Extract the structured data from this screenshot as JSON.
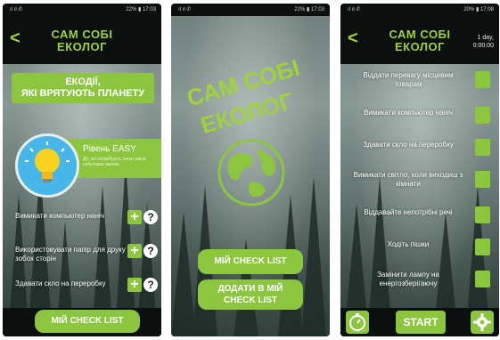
{
  "screen1": {
    "status_left": "ıl ıl ✆",
    "status_right": "22% ▮ 17:03",
    "title_line1": "САМ СОБІ",
    "title_line2": "ЕКОЛОГ",
    "banner_line1": "ЕКОДІЇ,",
    "banner_line2": "ЯКІ ВРЯТУЮТЬ ПЛАНЕТУ",
    "level_title": "Рівень EASY",
    "level_desc": "Дії, які потребують лише зміни побутових звичок",
    "tasks": [
      {
        "label": "Вимикати компьютер наніч"
      },
      {
        "label": "Використовувати папір для друку зобох сторін"
      },
      {
        "label": "Здавати скло на переробку"
      }
    ],
    "checklist_button": "МІЙ CHECK LIST"
  },
  "screen2": {
    "status_left": "ıl ıl ✆",
    "status_right": "22% ▮ 17:03",
    "logo_line1": "САМ СОБІ",
    "logo_line2": "ЕКОЛОГ",
    "checklist_button": "МІЙ CHECK LIST",
    "add_line1": "ДОДАТИ В МІЙ",
    "add_line2": "CHECK LIST"
  },
  "screen3": {
    "status_left": "ıl ıl ✆",
    "status_right": "20% ▮ 17:08",
    "title_line1": "САМ СОБІ",
    "title_line2": "ЕКОЛОГ",
    "timer_line1": "1 day,",
    "timer_line2": "0:00:00",
    "items": [
      {
        "label": "Віддати перевагу місцевим товарам"
      },
      {
        "label": "Вимикати компьютер наніч"
      },
      {
        "label": "Здавати скло на переробку"
      },
      {
        "label": "Вимикати світло, коли виходиш з кімнати"
      },
      {
        "label": "Віддавайте непотрібні речі"
      },
      {
        "label": "Ходіть пішки"
      },
      {
        "label": "Замінити лампу на енергозберігаючу"
      }
    ],
    "start_button": "START"
  },
  "icons": {
    "back": "chevron-left-icon",
    "add": "plus-icon",
    "help": "question-icon",
    "trash": "trash-icon",
    "timer": "stopwatch-icon",
    "settings": "gear-icon",
    "bulb": "lightbulb-icon",
    "globe": "globe-icon"
  },
  "colors": {
    "accent": "#8cc63f",
    "dark": "#0b0f0e"
  }
}
